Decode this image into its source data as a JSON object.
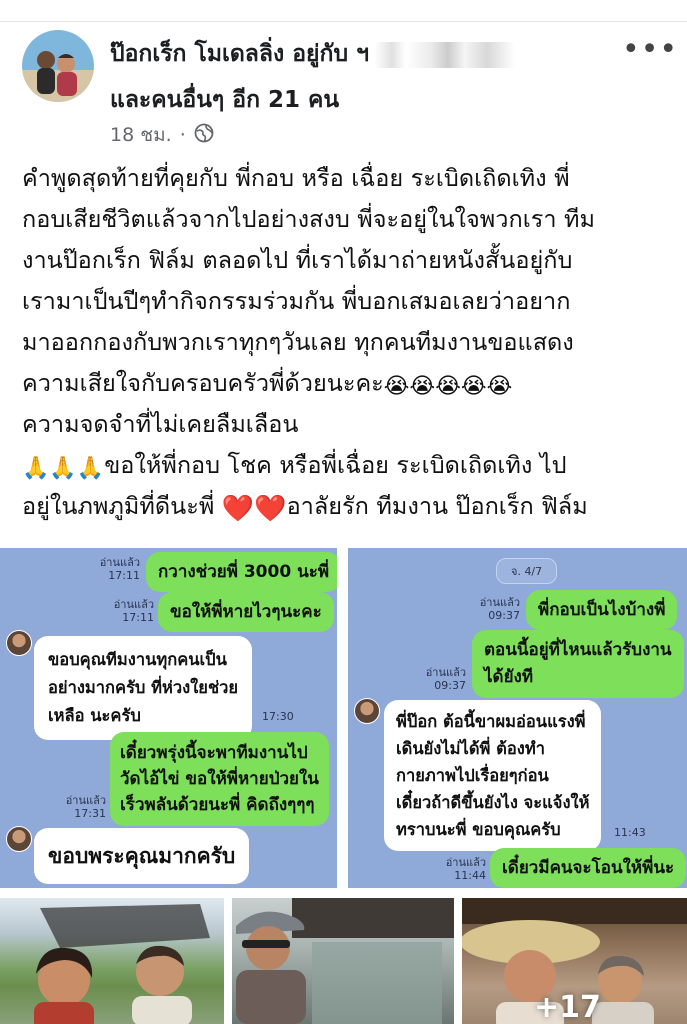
{
  "post": {
    "author_name": "ป๊อกเร็ก โมเดลลิ่ง",
    "with_text": "อยู่กับ",
    "with_prefix": "ฯ",
    "others_text": "และคนอื่นๆ อีก 21 คน",
    "time": "18 ชม.",
    "dot": "·",
    "privacy_icon": "globe-icon",
    "more_icon": "more-horizontal-icon",
    "more_glyph": "•••",
    "text_lines": [
      "คำพูดสุดท้ายที่คุยกับ พี่กอบ หรือ เฉื่อย ระเบิดเถิดเทิง พี่",
      "กอบเสียชีวิตแล้วจากไปอย่างสงบ พี่จะอยู่ในใจพวกเรา ทีม",
      "งานป๊อกเร็ก ฟิล์ม ตลอดไป ที่เราได้มาถ่ายหนังสั้นอยู่กับ",
      "เรามาเป็นปีๆทำกิจกรรมร่วมกัน พี่บอกเสมอเลยว่าอยาก",
      "มาออกกองกับพวกเราทุกๆวันเลย ทุกคนทีมงานขอแสดง",
      "ความเสียใจกับครอบครัวพี่ด้วยนะคะ",
      "ความจดจำที่ไม่เคยลืมเลือน"
    ],
    "crying_emojis": "😭😭😭😭😭",
    "pray_emojis": "🙏🙏🙏",
    "line8_text": "ขอให้พี่กอบ โชค หรือพี่เฉื่อย ระเบิดเถิดเทิง ไป",
    "line9_text": "อยู่ในภพภูมิที่ดีนะพี่",
    "hearts": "❤️❤️",
    "line9_tail": "อาลัยรัก ทีมงาน ป๊อกเร็ก ฟิล์ม"
  },
  "chat_left": {
    "messages": [
      {
        "text": "กวางช่วยพี่ 3000 นะพี่",
        "read": "อ่านแล้ว",
        "time": "17:11"
      },
      {
        "text": "ขอให้พี่หายไวๆนะคะ",
        "read": "อ่านแล้ว",
        "time": "17:11"
      },
      {
        "lines": [
          "ขอบคุณทีมงานทุกคนเป็น",
          "อย่างมากครับ ที่ห่วงใยช่วย",
          "เหลือ นะครับ"
        ],
        "time": "17:30"
      },
      {
        "lines": [
          "เดี๋ยวพรุ่งนี้จะพาทีมงานไป",
          "วัดไอ้ไข่ ขอให้พี่หายป่วยใน",
          "เร็วพลันด้วยนะพี่ คิดถึงๆๆๆ"
        ],
        "read": "อ่านแล้ว",
        "time": "17:31"
      },
      {
        "text": "ขอบพระคุณมากครับ"
      }
    ]
  },
  "chat_right": {
    "date": "จ. 4/7",
    "messages": [
      {
        "text": "พี่กอบเป็นไงบ้างพี่",
        "read": "อ่านแล้ว",
        "time": "09:37"
      },
      {
        "lines": [
          "ตอนนี้อยู่ที่ไหนแล้วรับงาน",
          "ได้ยังที"
        ],
        "read": "อ่านแล้ว",
        "time": "09:37"
      },
      {
        "lines": [
          "พี่ป๊อก ต้อนี้ขาผมอ่อนแรงพี่",
          "เดินยังไม่ได้พี่ ต้องทำ",
          "กายภาพไปเรื่อยๆก่อน",
          "เดี๋ยวถ้าดีขึ้นยังไง จะแจ้งให้",
          "ทราบนะพี่ ขอบคุณครับ"
        ],
        "time": "11:43"
      },
      {
        "text": "เดี๋ยวมีคนจะโอนให้พี่นะ",
        "read": "อ่านแล้ว",
        "time": "11:44"
      }
    ]
  },
  "photos": {
    "more_count": "+17"
  }
}
